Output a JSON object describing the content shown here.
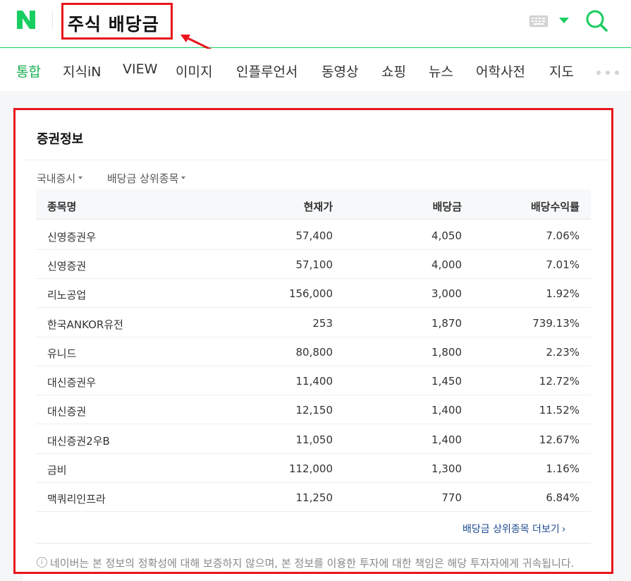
{
  "header": {
    "query": "주식 배당금",
    "colors": {
      "brand": "#19ce60",
      "annotation": "#e8151b"
    }
  },
  "tabs": [
    {
      "label": "통합",
      "active": true
    },
    {
      "label": "지식iN",
      "active": false
    },
    {
      "label": "VIEW",
      "active": false
    },
    {
      "label": "이미지",
      "active": false
    },
    {
      "label": "인플루언서",
      "active": false
    },
    {
      "label": "동영상",
      "active": false
    },
    {
      "label": "쇼핑",
      "active": false
    },
    {
      "label": "뉴스",
      "active": false
    },
    {
      "label": "어학사전",
      "active": false
    },
    {
      "label": "지도",
      "active": false
    }
  ],
  "card": {
    "title": "증권정보",
    "filters": [
      "국내증시",
      "배당금 상위종목"
    ],
    "columns": [
      "종목명",
      "현재가",
      "배당금",
      "배당수익률"
    ],
    "rows": [
      {
        "name": "신영증권우",
        "price": "57,400",
        "dividend": "4,050",
        "yield": "7.06%"
      },
      {
        "name": "신영증권",
        "price": "57,100",
        "dividend": "4,000",
        "yield": "7.01%"
      },
      {
        "name": "리노공업",
        "price": "156,000",
        "dividend": "3,000",
        "yield": "1.92%"
      },
      {
        "name": "한국ANKOR유전",
        "price": "253",
        "dividend": "1,870",
        "yield": "739.13%"
      },
      {
        "name": "유니드",
        "price": "80,800",
        "dividend": "1,800",
        "yield": "2.23%"
      },
      {
        "name": "대신증권우",
        "price": "11,400",
        "dividend": "1,450",
        "yield": "12.72%"
      },
      {
        "name": "대신증권",
        "price": "12,150",
        "dividend": "1,400",
        "yield": "11.52%"
      },
      {
        "name": "대신증권2우B",
        "price": "11,050",
        "dividend": "1,400",
        "yield": "12.67%"
      },
      {
        "name": "금비",
        "price": "112,000",
        "dividend": "1,300",
        "yield": "1.16%"
      },
      {
        "name": "맥쿼리인프라",
        "price": "11,250",
        "dividend": "770",
        "yield": "6.84%"
      }
    ],
    "more_link": "배당금 상위종목 더보기",
    "disclaimer": "네이버는 본 정보의 정확성에 대해 보증하지 않으며, 본 정보를 이용한 투자에 대한 책임은 해당 투자자에게 귀속됩니다."
  }
}
